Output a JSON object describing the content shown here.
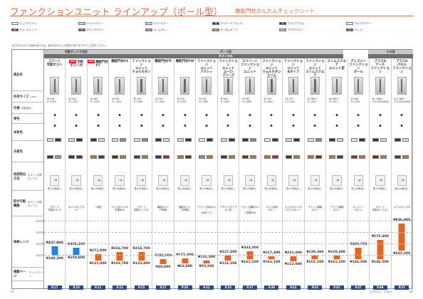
{
  "header": {
    "title": "ファンクションユニット ラインアップ（ポール型）",
    "subtitle": "機能門柱かんたんチェックシート"
  },
  "legend": [
    {
      "code": "PX",
      "label": "ピュアホワイト",
      "color": "#eeeeee"
    },
    {
      "code": "GX",
      "label": "シャイングレー",
      "color": "#bfbfbf"
    },
    {
      "code": "SS",
      "label": "ステンカラー",
      "color": "#c9c9c9"
    },
    {
      "code": "CB",
      "label": "チャコールブラック",
      "color": "#333333"
    },
    {
      "code": "BP",
      "label": "ブラックプラム",
      "color": "#3a2a2a"
    },
    {
      "code": "AW",
      "label": "アルミホワイト",
      "color": "#e6e6e6"
    },
    {
      "code": "WB",
      "label": "ウォールナット",
      "color": "#5a3b28"
    },
    {
      "code": "SB",
      "label": "ステンブラウン",
      "color": "#6a4a33"
    },
    {
      "code": "CG",
      "label": "カームグレー",
      "color": "#8a8a8a"
    },
    {
      "code": "OK",
      "label": "オータムオーク",
      "color": "#b07a45"
    },
    {
      "code": "PG",
      "label": "プラチナグレー",
      "color": "#a8a8a8"
    },
    {
      "code": "CH",
      "label": "チェリー",
      "color": "#8a3a2a"
    }
  ],
  "note": "※左右のポストの組み合わせは、組み合わせ上の設定がありますのでご注意ください。",
  "categories": {
    "top": [
      "宅配ボックス対応",
      "ポール型",
      "その他"
    ],
    "sub": [
      "ポストのみ"
    ]
  },
  "row_labels": [
    {
      "label": "商品名",
      "sub": ""
    },
    {
      "label": "外形サイズ",
      "sub": "(mm)"
    },
    {
      "label": "仕様",
      "sub": "戸建/集合"
    },
    {
      "label": "単色",
      "sub": ""
    },
    {
      "label": "本体色",
      "sub": ""
    },
    {
      "label": "天板色",
      "sub": ""
    },
    {
      "label": "投函取出方法",
      "sub": "ポスト / 宅配ボックス"
    },
    {
      "label": "取付可能機器",
      "sub": "ポスト / 宅配ボックス"
    },
    {
      "label": "価格レンジ",
      "sub": ""
    },
    {
      "label": "掲載ページ",
      "sub": "チェックシート"
    }
  ],
  "axis_ticks": [
    "40万円",
    "30万円",
    "20万円",
    "10万円"
  ],
  "products": [
    {
      "name": "スマート\n宅配ポスト",
      "new": false,
      "size": "W 426\nH 1,353",
      "install": "前入れ後出し",
      "devices": "スマート\n宅配ポストF",
      "price_high": "¥437,800",
      "price_low": "¥240,200",
      "page": "P.17",
      "body": [
        "#d9d9d9",
        "#3a3a3a"
      ],
      "top": [
        "#3a3a3a",
        "#999999"
      ]
    },
    {
      "name": "宅配\nポスト付",
      "new": true,
      "size": "W 426\nH 1,353",
      "install": "前入れ後出し",
      "devices": "ポストボックス\nF5",
      "price_high": "¥406,300",
      "price_low": "¥250,800",
      "page": "P.19",
      "body": [
        "#d9d9d9",
        "#3a3a3a"
      ],
      "top": [
        "#3a3a3a",
        "#5a3b28"
      ]
    },
    {
      "name": "機能門柱FT",
      "new": true,
      "size": "W 165\nH 1,500",
      "install": "前入れ後出し",
      "devices": "一体型",
      "price_high": "¥271,000",
      "price_low": "¥121,000",
      "page": "P.21",
      "body": [
        "#3a3a3a",
        "#d9d9d9"
      ],
      "top": [
        "#b07a45",
        "#5a3b28"
      ]
    },
    {
      "name": "機能門柱FS",
      "new": false,
      "size": "W 430\nH 1,354",
      "install": "前入れ後出し",
      "devices": "エクスポストFS\n宅配BOX",
      "price_high": "¥316,700",
      "price_low": "¥133,700",
      "page": "P.23",
      "body": [
        "#d9d9d9",
        "#8a8a8a"
      ],
      "top": [
        "#3a3a3a",
        "#b07a45"
      ]
    },
    {
      "name": "ファンクション\nユニット\nウォルモダン",
      "new": false,
      "size": "W 320\nH 1,600",
      "install": "前入れ後出し",
      "devices": "スマート\n宅配ボックスL",
      "price_high": "¥316,700",
      "price_low": "¥123,400",
      "page": "P.25",
      "body": [
        "#e6e6e6",
        "#8a8a8a"
      ],
      "top": [
        "#5a3b28",
        "#b07a45"
      ]
    },
    {
      "name": "機能門柱FP",
      "new": false,
      "size": "W 320\nH 1,550",
      "install": "前入れ後出し",
      "devices": "機能ポスト\nFP専用",
      "price_high": "¥150,900",
      "price_low": "¥49,000",
      "page": "P.27",
      "body": [
        "#3a3a3a",
        "#d9d9d9"
      ],
      "top": [
        "#3a3a3a",
        "#8a3a2a"
      ]
    },
    {
      "name": "機能門柱FW",
      "new": false,
      "size": "W 320\nH 1,500",
      "install": "前入れ後出し",
      "devices": "機能ポスト\nFW専用",
      "price_high": "¥171,400",
      "price_low": "¥62,400",
      "page": "P.29",
      "body": [
        "#d9d9d9",
        "#3a3a3a"
      ],
      "top": [
        "#b07a45",
        "#5a3b28"
      ]
    },
    {
      "name": "ファンクション\nユニット\nアクシィ",
      "new": false,
      "size": "W 200\nH 1,600",
      "install": "前入れ後出し",
      "devices": "アクシィ専用ポスト\n3段タイプ",
      "price_high": "¥132,200",
      "price_low": "¥55,500",
      "page": "P.31",
      "body": [
        "#e6e6e6",
        "#3a3a3a"
      ],
      "top": [
        "#8a8a8a",
        "#b07a45"
      ]
    },
    {
      "name": "ファンクション\nユニット\nユーロ\nブリーズ",
      "new": false,
      "size": "W 420\nH 1,600",
      "install": "前入れ後出し",
      "devices": "デザインタイプ\nD-1型",
      "price_high": "¥227,400",
      "price_low": "¥131,100",
      "page": "P.35",
      "body": [
        "#d9d9d9",
        "#3a3a3a"
      ],
      "top": [
        "#3a3a3a",
        "#b07a45"
      ]
    },
    {
      "name": "スクリーン\nファンクション\nユニット",
      "new": false,
      "size": "W 260\nH 1,685",
      "install": "前入れ後出し",
      "devices": "ブラック機能ポスト\n＋宅配BOX",
      "price_high": "¥333,300",
      "price_low": "¥161,100",
      "page": "P.37",
      "body": [
        "#3a3a3a",
        "#8a8a8a"
      ],
      "top": [
        "#5a3b28",
        "#b07a45"
      ]
    },
    {
      "name": "ファンクション\nユニット\nウォルモダン\nスリム",
      "new": false,
      "size": "W 150\nH 1,600",
      "install": "前入れ後出し",
      "devices": "スリム専用\nポスト",
      "price_high": "¥217,400",
      "price_low": "¥161,100",
      "page": "P.39",
      "body": [
        "#e6e6e6",
        "#3a3a3a"
      ],
      "top": [
        "#b07a45",
        "#8a3a2a"
      ]
    },
    {
      "name": "ファンクション\nユニット\nAタイプ",
      "new": false,
      "size": "W 270\nH 1,445",
      "install": "前入れ後出し",
      "devices": "エクスポストFS\nFエクスポート",
      "price_high": "¥221,000",
      "price_low": "¥112,000",
      "page": "P.41",
      "body": [
        "#d9d9d9",
        "#3a3a3a"
      ],
      "top": [
        "#3a3a3a",
        "#b07a45"
      ]
    },
    {
      "name": "ファンクション\nユニット\nスリムスクエア",
      "new": false,
      "size": "W 186.5\nH 1,617",
      "install": "前入れ後出し",
      "devices": "ブラック機能\nポスト",
      "price_high": "¥229,300",
      "price_low": "¥161,100",
      "page": "P.43",
      "body": [
        "#e6e6e6",
        "#8a8a8a"
      ],
      "top": [
        "#b07a45",
        "#5a3b28"
      ]
    },
    {
      "name": "スリムスクエア\nユニット型",
      "new": false,
      "size": "W 186.5\nH 1,617",
      "install": "前入れ後出し",
      "devices": "ブラック機能\nポスト",
      "price_high": "¥229,300",
      "price_low": "¥161,100",
      "page": "P.45",
      "body": [
        "#3a3a3a",
        "#d9d9d9"
      ],
      "top": [
        "#b07a45",
        "#5a3b28"
      ]
    },
    {
      "name": "ディズニー\nファンクション\nポール",
      "new": false,
      "size": "W 448\nH 1,556",
      "install": "前入れ後出し",
      "devices": "ディズニー\nポスト",
      "price_high": "¥409,700",
      "price_low": "¥146,500",
      "page": "P.47",
      "body": [
        "#e6e6e6",
        "#3a3a3a"
      ],
      "top": [
        "#8a3a2a",
        "#b07a45"
      ]
    },
    {
      "name": "プラスG\nアーチ\nファンクション",
      "new": false,
      "size": "W 1,680~\nH 2,450(2600)",
      "install": "前入れ後出し",
      "devices": "スマート\n宅配ボックスL",
      "price_high": "¥575,400",
      "price_low": "¥146,500",
      "page": "P.49",
      "body": [
        "#3a3a3a",
        "#d9d9d9"
      ],
      "top": [
        "#5a3b28",
        "#b07a45"
      ]
    },
    {
      "name": "プラスG\nパネル\nファンクション",
      "new": false,
      "size": "W 1,680~\nH 2,450(2600)",
      "install": "前入れ後出し",
      "devices": "エクスポストFS",
      "price_high": "¥936,800",
      "price_low": "¥345,300",
      "page": "P.51",
      "body": [
        "#3a3a3a",
        "#d9d9d9"
      ],
      "top": [
        "#5a3b28",
        "#b07a45"
      ]
    }
  ],
  "bar_levels": [
    {
      "high": 0.44,
      "low": 0.24
    },
    {
      "high": 0.41,
      "low": 0.25
    },
    {
      "high": 0.27,
      "low": 0.12
    },
    {
      "high": 0.32,
      "low": 0.13
    },
    {
      "high": 0.32,
      "low": 0.12
    },
    {
      "high": 0.15,
      "low": 0.05
    },
    {
      "high": 0.17,
      "low": 0.06
    },
    {
      "high": 0.13,
      "low": 0.06
    },
    {
      "high": 0.23,
      "low": 0.13
    },
    {
      "high": 0.33,
      "low": 0.16
    },
    {
      "high": 0.22,
      "low": 0.16
    },
    {
      "high": 0.22,
      "low": 0.11
    },
    {
      "high": 0.23,
      "low": 0.16
    },
    {
      "high": 0.23,
      "low": 0.16
    },
    {
      "high": 0.41,
      "low": 0.15
    },
    {
      "high": 0.58,
      "low": 0.15
    },
    {
      "high": 0.94,
      "low": 0.35
    }
  ],
  "colors": {
    "accent": "#e8643c",
    "bar_blue": "#1a86e0",
    "bar_orange": "#e8641e",
    "page_tag": "#2a4a8a"
  },
  "footer": {
    "left": "33",
    "right": "34",
    "code": "0109(24)　◎0800"
  }
}
